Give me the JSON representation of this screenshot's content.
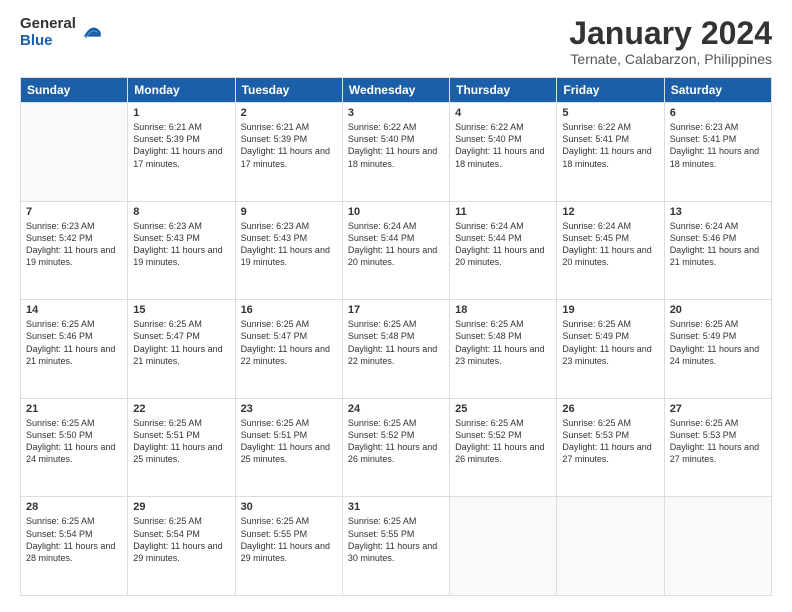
{
  "logo": {
    "general": "General",
    "blue": "Blue"
  },
  "title": "January 2024",
  "subtitle": "Ternate, Calabarzon, Philippines",
  "days_header": [
    "Sunday",
    "Monday",
    "Tuesday",
    "Wednesday",
    "Thursday",
    "Friday",
    "Saturday"
  ],
  "weeks": [
    [
      {
        "day": "",
        "sunrise": "",
        "sunset": "",
        "daylight": ""
      },
      {
        "day": "1",
        "sunrise": "Sunrise: 6:21 AM",
        "sunset": "Sunset: 5:39 PM",
        "daylight": "Daylight: 11 hours and 17 minutes."
      },
      {
        "day": "2",
        "sunrise": "Sunrise: 6:21 AM",
        "sunset": "Sunset: 5:39 PM",
        "daylight": "Daylight: 11 hours and 17 minutes."
      },
      {
        "day": "3",
        "sunrise": "Sunrise: 6:22 AM",
        "sunset": "Sunset: 5:40 PM",
        "daylight": "Daylight: 11 hours and 18 minutes."
      },
      {
        "day": "4",
        "sunrise": "Sunrise: 6:22 AM",
        "sunset": "Sunset: 5:40 PM",
        "daylight": "Daylight: 11 hours and 18 minutes."
      },
      {
        "day": "5",
        "sunrise": "Sunrise: 6:22 AM",
        "sunset": "Sunset: 5:41 PM",
        "daylight": "Daylight: 11 hours and 18 minutes."
      },
      {
        "day": "6",
        "sunrise": "Sunrise: 6:23 AM",
        "sunset": "Sunset: 5:41 PM",
        "daylight": "Daylight: 11 hours and 18 minutes."
      }
    ],
    [
      {
        "day": "7",
        "sunrise": "Sunrise: 6:23 AM",
        "sunset": "Sunset: 5:42 PM",
        "daylight": "Daylight: 11 hours and 19 minutes."
      },
      {
        "day": "8",
        "sunrise": "Sunrise: 6:23 AM",
        "sunset": "Sunset: 5:43 PM",
        "daylight": "Daylight: 11 hours and 19 minutes."
      },
      {
        "day": "9",
        "sunrise": "Sunrise: 6:23 AM",
        "sunset": "Sunset: 5:43 PM",
        "daylight": "Daylight: 11 hours and 19 minutes."
      },
      {
        "day": "10",
        "sunrise": "Sunrise: 6:24 AM",
        "sunset": "Sunset: 5:44 PM",
        "daylight": "Daylight: 11 hours and 20 minutes."
      },
      {
        "day": "11",
        "sunrise": "Sunrise: 6:24 AM",
        "sunset": "Sunset: 5:44 PM",
        "daylight": "Daylight: 11 hours and 20 minutes."
      },
      {
        "day": "12",
        "sunrise": "Sunrise: 6:24 AM",
        "sunset": "Sunset: 5:45 PM",
        "daylight": "Daylight: 11 hours and 20 minutes."
      },
      {
        "day": "13",
        "sunrise": "Sunrise: 6:24 AM",
        "sunset": "Sunset: 5:46 PM",
        "daylight": "Daylight: 11 hours and 21 minutes."
      }
    ],
    [
      {
        "day": "14",
        "sunrise": "Sunrise: 6:25 AM",
        "sunset": "Sunset: 5:46 PM",
        "daylight": "Daylight: 11 hours and 21 minutes."
      },
      {
        "day": "15",
        "sunrise": "Sunrise: 6:25 AM",
        "sunset": "Sunset: 5:47 PM",
        "daylight": "Daylight: 11 hours and 21 minutes."
      },
      {
        "day": "16",
        "sunrise": "Sunrise: 6:25 AM",
        "sunset": "Sunset: 5:47 PM",
        "daylight": "Daylight: 11 hours and 22 minutes."
      },
      {
        "day": "17",
        "sunrise": "Sunrise: 6:25 AM",
        "sunset": "Sunset: 5:48 PM",
        "daylight": "Daylight: 11 hours and 22 minutes."
      },
      {
        "day": "18",
        "sunrise": "Sunrise: 6:25 AM",
        "sunset": "Sunset: 5:48 PM",
        "daylight": "Daylight: 11 hours and 23 minutes."
      },
      {
        "day": "19",
        "sunrise": "Sunrise: 6:25 AM",
        "sunset": "Sunset: 5:49 PM",
        "daylight": "Daylight: 11 hours and 23 minutes."
      },
      {
        "day": "20",
        "sunrise": "Sunrise: 6:25 AM",
        "sunset": "Sunset: 5:49 PM",
        "daylight": "Daylight: 11 hours and 24 minutes."
      }
    ],
    [
      {
        "day": "21",
        "sunrise": "Sunrise: 6:25 AM",
        "sunset": "Sunset: 5:50 PM",
        "daylight": "Daylight: 11 hours and 24 minutes."
      },
      {
        "day": "22",
        "sunrise": "Sunrise: 6:25 AM",
        "sunset": "Sunset: 5:51 PM",
        "daylight": "Daylight: 11 hours and 25 minutes."
      },
      {
        "day": "23",
        "sunrise": "Sunrise: 6:25 AM",
        "sunset": "Sunset: 5:51 PM",
        "daylight": "Daylight: 11 hours and 25 minutes."
      },
      {
        "day": "24",
        "sunrise": "Sunrise: 6:25 AM",
        "sunset": "Sunset: 5:52 PM",
        "daylight": "Daylight: 11 hours and 26 minutes."
      },
      {
        "day": "25",
        "sunrise": "Sunrise: 6:25 AM",
        "sunset": "Sunset: 5:52 PM",
        "daylight": "Daylight: 11 hours and 26 minutes."
      },
      {
        "day": "26",
        "sunrise": "Sunrise: 6:25 AM",
        "sunset": "Sunset: 5:53 PM",
        "daylight": "Daylight: 11 hours and 27 minutes."
      },
      {
        "day": "27",
        "sunrise": "Sunrise: 6:25 AM",
        "sunset": "Sunset: 5:53 PM",
        "daylight": "Daylight: 11 hours and 27 minutes."
      }
    ],
    [
      {
        "day": "28",
        "sunrise": "Sunrise: 6:25 AM",
        "sunset": "Sunset: 5:54 PM",
        "daylight": "Daylight: 11 hours and 28 minutes."
      },
      {
        "day": "29",
        "sunrise": "Sunrise: 6:25 AM",
        "sunset": "Sunset: 5:54 PM",
        "daylight": "Daylight: 11 hours and 29 minutes."
      },
      {
        "day": "30",
        "sunrise": "Sunrise: 6:25 AM",
        "sunset": "Sunset: 5:55 PM",
        "daylight": "Daylight: 11 hours and 29 minutes."
      },
      {
        "day": "31",
        "sunrise": "Sunrise: 6:25 AM",
        "sunset": "Sunset: 5:55 PM",
        "daylight": "Daylight: 11 hours and 30 minutes."
      },
      {
        "day": "",
        "sunrise": "",
        "sunset": "",
        "daylight": ""
      },
      {
        "day": "",
        "sunrise": "",
        "sunset": "",
        "daylight": ""
      },
      {
        "day": "",
        "sunrise": "",
        "sunset": "",
        "daylight": ""
      }
    ]
  ]
}
